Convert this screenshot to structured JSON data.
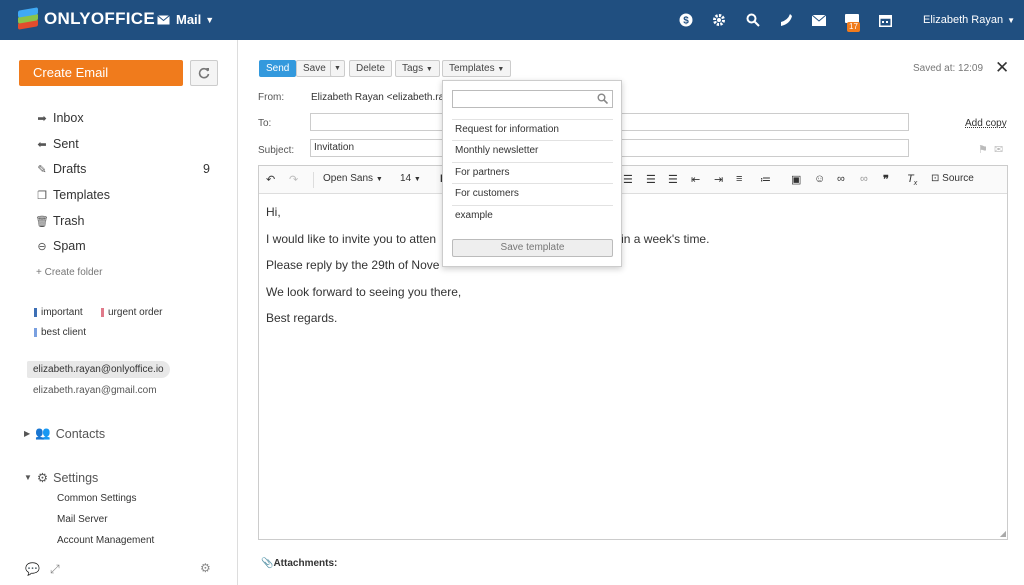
{
  "app": {
    "logo_text": "ONLYOFFICE",
    "module": "Mail",
    "user_name": "Elizabeth Rayan",
    "notification_count": "17",
    "top_icons": [
      "dollar-icon",
      "settings-icon",
      "search-icon",
      "feed-icon",
      "mail-icon",
      "chat-icon",
      "calendar-icon"
    ]
  },
  "sidebar": {
    "create_email": "Create Email",
    "folders": [
      {
        "label": "Inbox",
        "icon": "inbox-icon",
        "count": ""
      },
      {
        "label": "Sent",
        "icon": "sent-icon",
        "count": ""
      },
      {
        "label": "Drafts",
        "icon": "drafts-icon",
        "count": "9"
      },
      {
        "label": "Templates",
        "icon": "templates-icon",
        "count": ""
      },
      {
        "label": "Trash",
        "icon": "trash-icon",
        "count": ""
      },
      {
        "label": "Spam",
        "icon": "spam-icon",
        "count": ""
      }
    ],
    "create_folder": "+ Create folder",
    "tags": [
      {
        "label": "important",
        "color": "#3d6fb5"
      },
      {
        "label": "urgent order",
        "color": "#e07a8a"
      },
      {
        "label": "best client",
        "color": "#7aa0e0"
      }
    ],
    "accounts": [
      "elizabeth.rayan@onlyoffice.io",
      "elizabeth.rayan@gmail.com"
    ],
    "contacts_label": "Contacts",
    "settings_label": "Settings",
    "settings_items": [
      "Common Settings",
      "Mail Server",
      "Account Management"
    ]
  },
  "compose": {
    "buttons": {
      "send": "Send",
      "save": "Save",
      "delete": "Delete",
      "tags": "Tags",
      "templates": "Templates"
    },
    "saved_at": "Saved at: 12:09",
    "from_label": "From:",
    "from_value": "Elizabeth Rayan <elizabeth.ra",
    "to_label": "To:",
    "to_value": "",
    "add_copy": "Add copy",
    "subject_label": "Subject:",
    "subject_value": "Invitation",
    "editor": {
      "font": "Open Sans",
      "size": "14",
      "source_label": "Source"
    },
    "body": [
      "Hi,",
      "I would like to invite you to atten",
      "d in a week's time.",
      "Please reply by the 29th of Nove",
      "We look forward to seeing you there,",
      "Best regards."
    ],
    "attachments_label": "Attachments:"
  },
  "templates_dropdown": {
    "search_placeholder": "",
    "items": [
      "Request for information",
      "Monthly newsletter",
      "For partners",
      "For customers",
      "example"
    ],
    "save_label": "Save template"
  }
}
